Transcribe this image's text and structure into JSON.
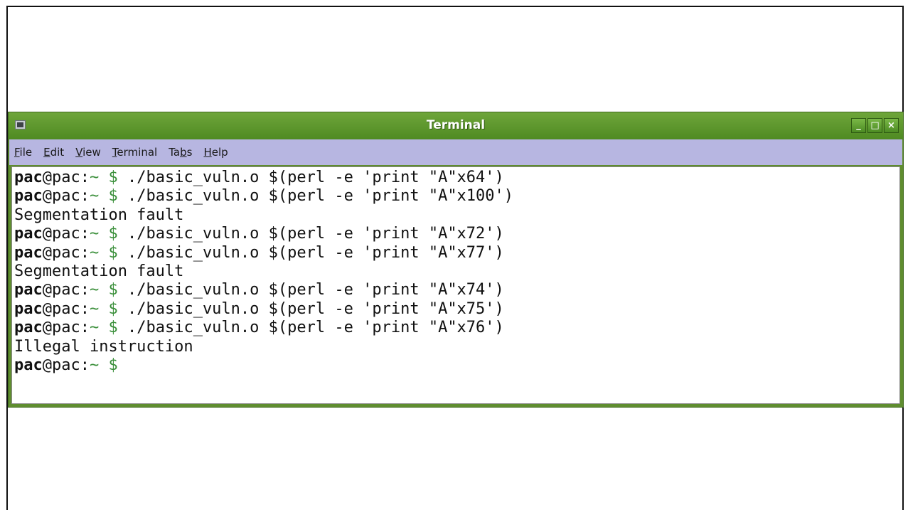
{
  "window": {
    "title": "Terminal",
    "controls": {
      "minimize": "_",
      "maximize": "□",
      "close": "×"
    }
  },
  "menu": [
    {
      "pre": "",
      "mnemonic": "F",
      "post": "ile"
    },
    {
      "pre": "",
      "mnemonic": "E",
      "post": "dit"
    },
    {
      "pre": "",
      "mnemonic": "V",
      "post": "iew"
    },
    {
      "pre": "",
      "mnemonic": "T",
      "post": "erminal"
    },
    {
      "pre": "Ta",
      "mnemonic": "b",
      "post": "s"
    },
    {
      "pre": "",
      "mnemonic": "H",
      "post": "elp"
    }
  ],
  "prompt": {
    "user": "pac",
    "at_host": "@pac:",
    "path": "~ $"
  },
  "lines": [
    {
      "prompt": true,
      "text": " ./basic_vuln.o $(perl -e 'print \"A\"x64')"
    },
    {
      "prompt": true,
      "text": " ./basic_vuln.o $(perl -e 'print \"A\"x100')"
    },
    {
      "prompt": false,
      "text": "Segmentation fault"
    },
    {
      "prompt": true,
      "text": " ./basic_vuln.o $(perl -e 'print \"A\"x72')"
    },
    {
      "prompt": true,
      "text": " ./basic_vuln.o $(perl -e 'print \"A\"x77')"
    },
    {
      "prompt": false,
      "text": "Segmentation fault"
    },
    {
      "prompt": true,
      "text": " ./basic_vuln.o $(perl -e 'print \"A\"x74')"
    },
    {
      "prompt": true,
      "text": " ./basic_vuln.o $(perl -e 'print \"A\"x75')"
    },
    {
      "prompt": true,
      "text": " ./basic_vuln.o $(perl -e 'print \"A\"x76')"
    },
    {
      "prompt": false,
      "text": "Illegal instruction"
    },
    {
      "prompt": true,
      "text": ""
    }
  ],
  "colors": {
    "titlebar": "#5f8d2f",
    "menubar": "#b7b6e1",
    "prompt_path": "#3a8f3a"
  },
  "icons": {
    "app": "terminal-icon",
    "minimize": "minimize-icon",
    "maximize": "maximize-icon",
    "close": "close-icon"
  }
}
